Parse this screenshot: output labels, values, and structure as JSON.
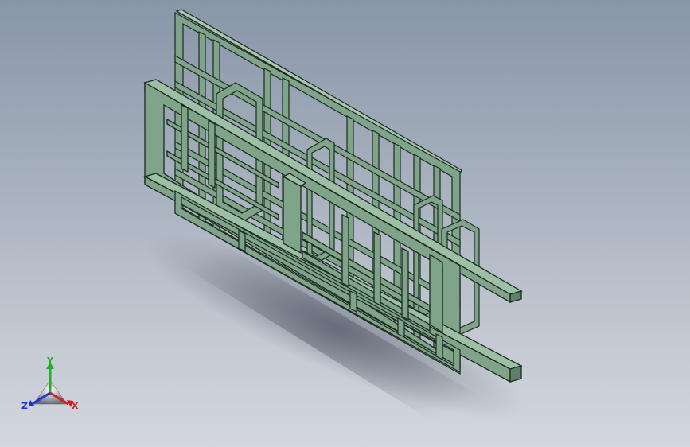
{
  "viewport": {
    "background_top": "#8996a8",
    "background_bottom": "#d3d7dd"
  },
  "model": {
    "description_icon": "steel-frame-assembly",
    "fill_color": "#7fa48a",
    "edge_color": "#1c2a20",
    "dark_color": "#5f8068"
  },
  "triad": {
    "x_label": "X",
    "y_label": "Y",
    "z_label": "Z",
    "x_color": "#d22020",
    "y_color": "#20b020",
    "z_color": "#2030d0"
  }
}
